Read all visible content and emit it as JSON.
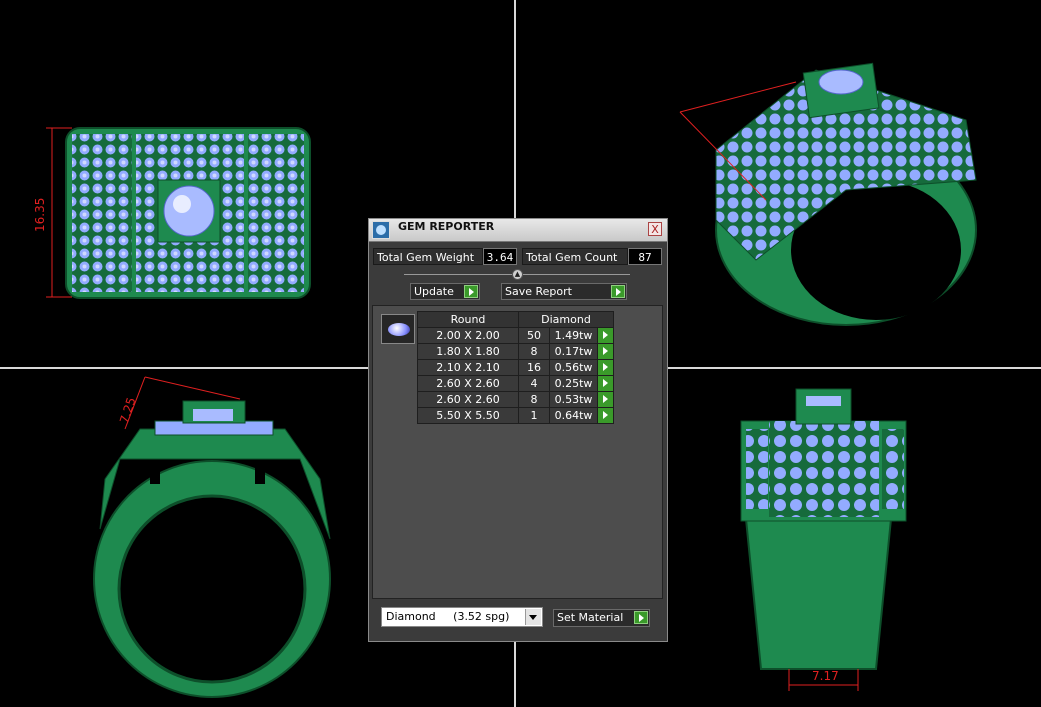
{
  "views": {
    "top_left_dimension": "16.35",
    "bottom_left_dimension": "7.25",
    "bottom_right_dimension": "7.17"
  },
  "dialog": {
    "title": "GEM REPORTER",
    "close": "X",
    "total_weight_label": "Total Gem Weight",
    "total_weight_value": "3.64",
    "total_count_label": "Total Gem Count",
    "total_count_value": "87",
    "update_label": "Update",
    "save_report_label": "Save Report",
    "table": {
      "shape_header": "Round",
      "material_header": "Diamond",
      "rows": [
        {
          "size": "2.00 X 2.00",
          "count": "50",
          "weight": "1.49tw"
        },
        {
          "size": "1.80 X 1.80",
          "count": "8",
          "weight": "0.17tw"
        },
        {
          "size": "2.10 X 2.10",
          "count": "16",
          "weight": "0.56tw"
        },
        {
          "size": "2.60 X 2.60",
          "count": "4",
          "weight": "0.25tw"
        },
        {
          "size": "2.60 X 2.60",
          "count": "8",
          "weight": "0.53tw"
        },
        {
          "size": "5.50 X 5.50",
          "count": "1",
          "weight": "0.64tw"
        }
      ]
    },
    "material_select_value": "Diamond     (3.52 spg)",
    "set_material_label": "Set Material"
  },
  "colors": {
    "metal": "#1e8a4f",
    "gem": "#8fa8ff",
    "dimension": "#e02020",
    "background": "#000000"
  }
}
